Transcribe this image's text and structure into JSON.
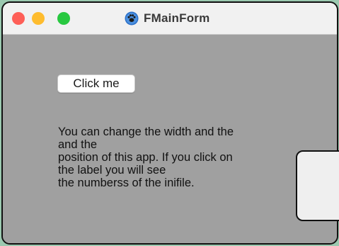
{
  "window": {
    "title": "FMainForm",
    "icon": "app-paw-icon",
    "controls": [
      {
        "name": "close",
        "color": "#fe5f57"
      },
      {
        "name": "minimize",
        "color": "#febc2e"
      },
      {
        "name": "zoom",
        "color": "#28c840"
      }
    ]
  },
  "content": {
    "button_label": "Click me",
    "label_lines": [
      "You can change the width and the",
      "and the",
      "position of this app. If you click on",
      "the label you will see",
      "the numberss of the inifile."
    ]
  },
  "colors": {
    "titlebar": "#f1f1f1",
    "content_bg": "#a0a0a0",
    "desktop_bg": "#9bc9b0"
  }
}
